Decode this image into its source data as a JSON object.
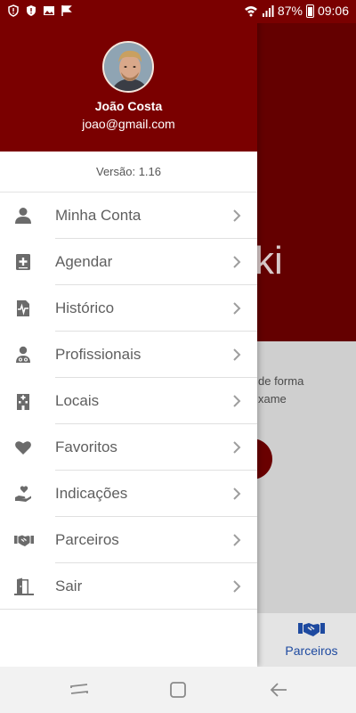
{
  "status_bar": {
    "battery": "87%",
    "time": "09:06"
  },
  "background": {
    "title_fragment": "ki",
    "text_line1": "de forma",
    "text_line2": "xame",
    "bottom_nav_active_label": "Parceiros"
  },
  "drawer": {
    "user": {
      "name": "João Costa",
      "email": "joao@gmail.com"
    },
    "version": "Versão: 1.16",
    "items": [
      {
        "label": "Minha Conta",
        "icon": "person-icon"
      },
      {
        "label": "Agendar",
        "icon": "calendar-plus-icon"
      },
      {
        "label": "Histórico",
        "icon": "medical-file-icon"
      },
      {
        "label": "Profissionais",
        "icon": "doctor-icon"
      },
      {
        "label": "Locais",
        "icon": "hospital-building-icon"
      },
      {
        "label": "Favoritos",
        "icon": "heart-icon"
      },
      {
        "label": "Indicações",
        "icon": "heart-hand-icon"
      },
      {
        "label": "Parceiros",
        "icon": "handshake-icon"
      },
      {
        "label": "Sair",
        "icon": "exit-door-icon"
      }
    ]
  },
  "colors": {
    "brand": "#7a0000",
    "icon_gray": "#6b6b6b",
    "nav_active": "#1e4aa0"
  }
}
